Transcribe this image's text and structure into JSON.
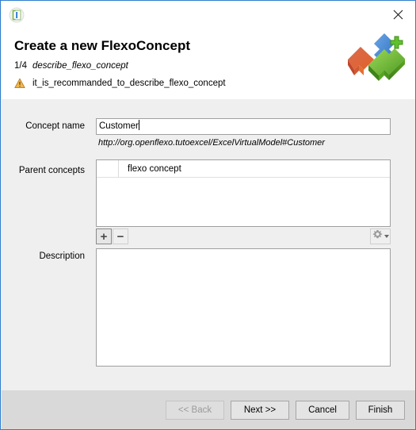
{
  "window": {
    "app_icon_name": "flexo-app-icon",
    "close_label": "×",
    "border_color": "#2f7fd0"
  },
  "header": {
    "title": "Create a new FlexoConcept",
    "step_counter": "1/4",
    "step_label": "describe_flexo_concept",
    "warning_icon_name": "warning-triangle-icon",
    "warning_text": "it_is_recommanded_to_describe_flexo_concept",
    "logo_icon_name": "flexo-concept-puzzle-logo",
    "logo_colors": {
      "red": "#c94f3a",
      "orange": "#e87b2a",
      "blue": "#3f86d6",
      "green": "#6fbf3a",
      "plus": "#5fc22a"
    },
    "warning_color": "#e8a33d"
  },
  "form": {
    "concept_name": {
      "label": "Concept name",
      "value": "Customer",
      "placeholder": ""
    },
    "concept_uri": "http://org.openflexo.tutoexcel/ExcelVirtualModel#Customer",
    "parent_concepts": {
      "label": "Parent concepts",
      "columns": [
        "",
        "flexo concept"
      ],
      "rows": [],
      "toolbar": {
        "add_label": "+",
        "add_name": "add-parent-concept-button",
        "remove_label": "−",
        "remove_name": "remove-parent-concept-button",
        "gear_name": "settings-gear-icon",
        "gear_caret_name": "chevron-down-icon"
      }
    },
    "description": {
      "label": "Description",
      "value": "",
      "placeholder": ""
    }
  },
  "footer": {
    "buttons": [
      {
        "label": "<< Back",
        "name": "back-button",
        "disabled": true
      },
      {
        "label": "Next >>",
        "name": "next-button",
        "disabled": false
      },
      {
        "label": "Cancel",
        "name": "cancel-button",
        "disabled": false
      },
      {
        "label": "Finish",
        "name": "finish-button",
        "disabled": false
      }
    ]
  }
}
